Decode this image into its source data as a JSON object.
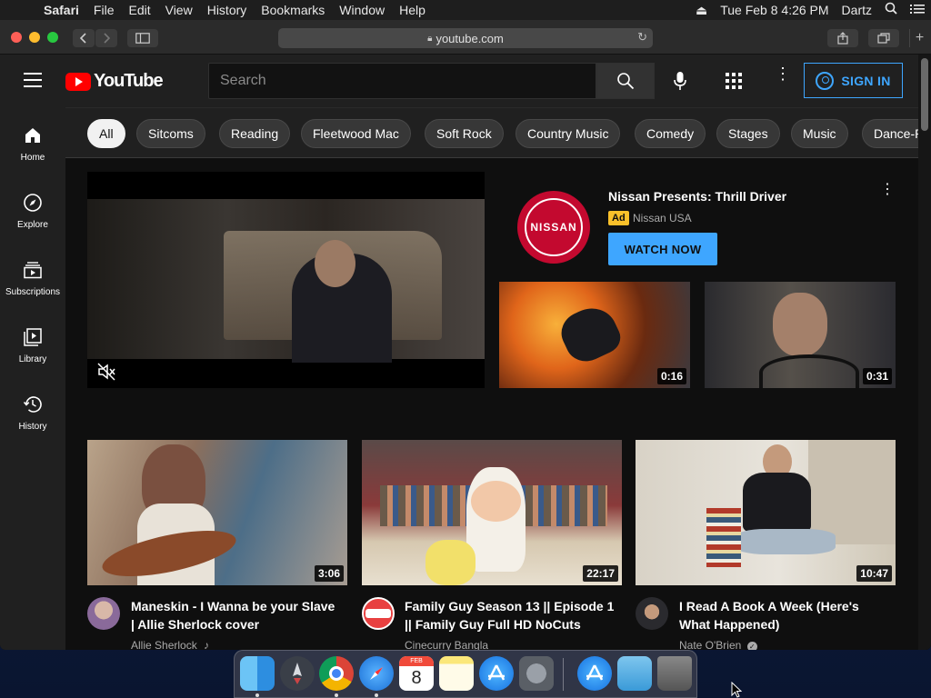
{
  "menubar": {
    "app": "Safari",
    "items": [
      "File",
      "Edit",
      "View",
      "History",
      "Bookmarks",
      "Window",
      "Help"
    ],
    "datetime": "Tue Feb 8  4:26 PM",
    "user": "Dartz"
  },
  "browser": {
    "url": "youtube.com"
  },
  "youtube": {
    "logo_text": "YouTube",
    "search_placeholder": "Search",
    "sign_in": "SIGN IN",
    "guide": [
      "Home",
      "Explore",
      "Subscriptions",
      "Library",
      "History"
    ],
    "chips": [
      "All",
      "Sitcoms",
      "Reading",
      "Fleetwood Mac",
      "Soft Rock",
      "Country Music",
      "Comedy",
      "Stages",
      "Music",
      "Dance-P"
    ],
    "ad": {
      "title": "Nissan Presents: Thrill Driver",
      "badge": "Ad",
      "channel": "Nissan USA",
      "button": "WATCH NOW",
      "logo_text": "NISSAN",
      "thumbs": [
        {
          "duration": "0:16"
        },
        {
          "duration": "0:31"
        }
      ]
    },
    "videos": [
      {
        "title_line1": "Maneskin - I Wanna be your Slave",
        "title_line2": "| Allie Sherlock cover",
        "channel": "Allie Sherlock",
        "duration": "3:06"
      },
      {
        "title_line1": "Family Guy Season 13 || Episode 1",
        "title_line2": "|| Family Guy Full HD NoCuts",
        "channel": "Cinecurry Bangla",
        "duration": "22:17"
      },
      {
        "title_line1": "I Read A Book A Week (Here's",
        "title_line2": "What Happened)",
        "channel": "Nate O'Brien",
        "duration": "10:47"
      }
    ]
  },
  "colors": {
    "yt_red": "#ff0000",
    "accent_blue": "#3ea6ff",
    "nissan_red": "#c3092f"
  }
}
